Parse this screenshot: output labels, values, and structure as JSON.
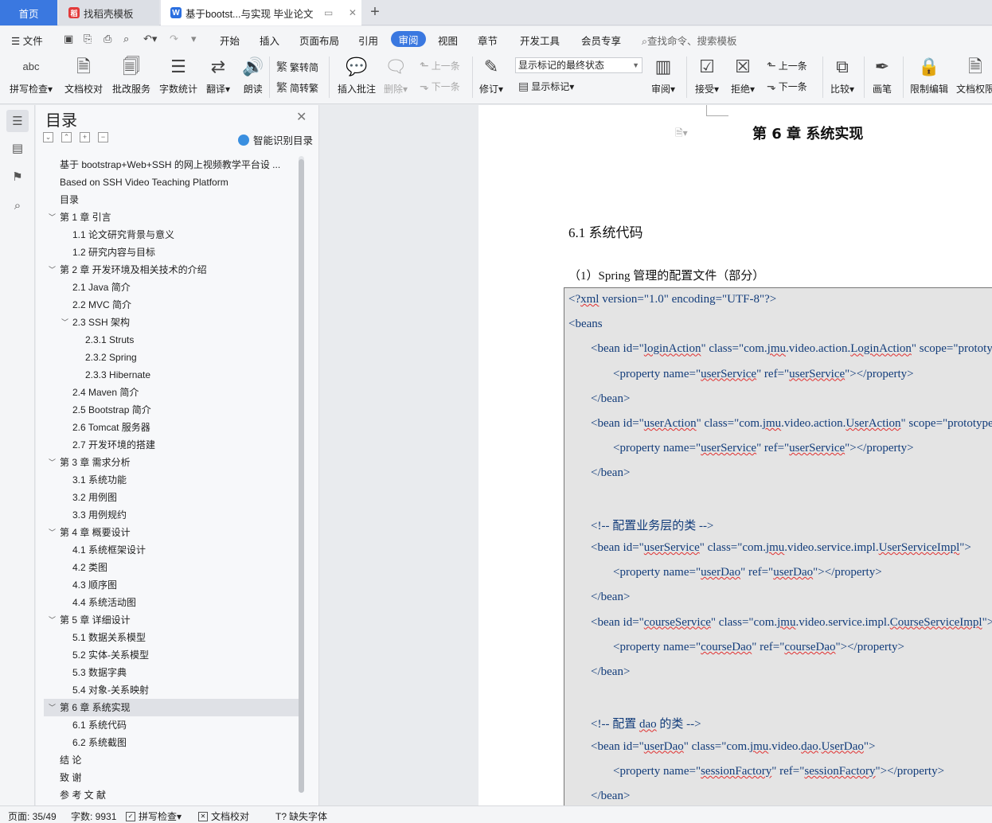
{
  "tabs": {
    "home": "首页",
    "template": "找稻壳模板",
    "doc": "基于bootst...与实现 毕业论文"
  },
  "menu": {
    "file": "文件",
    "items": [
      "开始",
      "插入",
      "页面布局",
      "引用",
      "视图",
      "章节",
      "开发工具",
      "会员专享"
    ],
    "active": "审阅",
    "search": "查找命令、搜索模板"
  },
  "ribbon": {
    "spell": "拼写检查",
    "proof": "文档校对",
    "batch": "批改服务",
    "wordcount": "字数统计",
    "translate": "翻译",
    "read": "朗读",
    "trad2simp": "繁转简",
    "simp2trad": "简转繁",
    "insert_comment": "插入批注",
    "delete": "删除",
    "prev_comment": "上一条",
    "next_comment": "下一条",
    "revise": "修订",
    "markup_state": "显示标记的最终状态",
    "show_markup": "显示标记",
    "review": "审阅",
    "accept": "接受",
    "reject": "拒绝",
    "prev_change": "上一条",
    "next_change": "下一条",
    "compare": "比较",
    "pen": "画笔",
    "restrict": "限制编辑",
    "doc_rights": "文档权限",
    "icon_abc": "abc"
  },
  "toc": {
    "title": "目录",
    "smart": "智能识别目录",
    "items": [
      {
        "t": "基于 bootstrap+Web+SSH 的网上视频教学平台设 ...",
        "lvl": 0,
        "car": ""
      },
      {
        "t": "Based on SSH Video Teaching Platform",
        "lvl": 0,
        "car": ""
      },
      {
        "t": "目录",
        "lvl": 0,
        "car": ""
      },
      {
        "t": "第 1 章  引言",
        "lvl": 0,
        "car": "v"
      },
      {
        "t": "1.1  论文研究背景与意义",
        "lvl": 1,
        "car": ""
      },
      {
        "t": "1.2  研究内容与目标",
        "lvl": 1,
        "car": ""
      },
      {
        "t": "第 2 章  开发环境及相关技术的介绍",
        "lvl": 0,
        "car": "v"
      },
      {
        "t": "2.1 Java 简介",
        "lvl": 1,
        "car": ""
      },
      {
        "t": "2.2 MVC 简介",
        "lvl": 1,
        "car": ""
      },
      {
        "t": "2.3 SSH 架构",
        "lvl": 1,
        "car": "v"
      },
      {
        "t": "2.3.1 Struts",
        "lvl": 2,
        "car": ""
      },
      {
        "t": "2.3.2 Spring",
        "lvl": 2,
        "car": ""
      },
      {
        "t": "2.3.3 Hibernate",
        "lvl": 2,
        "car": ""
      },
      {
        "t": "2.4 Maven 简介",
        "lvl": 1,
        "car": ""
      },
      {
        "t": "2.5 Bootstrap  简介",
        "lvl": 1,
        "car": ""
      },
      {
        "t": "2.6 Tomcat 服务器",
        "lvl": 1,
        "car": ""
      },
      {
        "t": "2.7  开发环境的搭建",
        "lvl": 1,
        "car": ""
      },
      {
        "t": "第 3 章  需求分析",
        "lvl": 0,
        "car": "v"
      },
      {
        "t": "3.1  系统功能",
        "lvl": 1,
        "car": ""
      },
      {
        "t": "3.2  用例图",
        "lvl": 1,
        "car": ""
      },
      {
        "t": "3.3  用例规约",
        "lvl": 1,
        "car": ""
      },
      {
        "t": "第 4 章  概要设计",
        "lvl": 0,
        "car": "v"
      },
      {
        "t": "4.1  系统框架设计",
        "lvl": 1,
        "car": ""
      },
      {
        "t": "4.2  类图",
        "lvl": 1,
        "car": ""
      },
      {
        "t": "4.3  顺序图",
        "lvl": 1,
        "car": ""
      },
      {
        "t": "4.4  系统活动图",
        "lvl": 1,
        "car": ""
      },
      {
        "t": "第 5 章  详细设计",
        "lvl": 0,
        "car": "v"
      },
      {
        "t": "5.1  数据关系模型",
        "lvl": 1,
        "car": ""
      },
      {
        "t": "5.2  实体-关系模型",
        "lvl": 1,
        "car": ""
      },
      {
        "t": "5.3  数据字典",
        "lvl": 1,
        "car": ""
      },
      {
        "t": "5.4  对象-关系映射",
        "lvl": 1,
        "car": ""
      },
      {
        "t": "第 6 章  系统实现",
        "lvl": 0,
        "car": "v",
        "sel": true
      },
      {
        "t": "6.1  系统代码",
        "lvl": 1,
        "car": ""
      },
      {
        "t": "6.2  系统截图",
        "lvl": 1,
        "car": ""
      },
      {
        "t": "结    论",
        "lvl": 0,
        "car": ""
      },
      {
        "t": "致    谢",
        "lvl": 0,
        "car": ""
      },
      {
        "t": "参 考 文 献",
        "lvl": 0,
        "car": ""
      }
    ]
  },
  "doc": {
    "chapter": "第 6 章  系统实现",
    "section": "6.1  系统代码",
    "subheading": "（1）Spring 管理的配置文件（部分）",
    "code": [
      {
        "i": 0,
        "s": [
          [
            "<?"
          ],
          [
            "xml",
            "w"
          ],
          [
            " version=\"1.0\" encoding=\"UTF-8\"?>"
          ]
        ]
      },
      {
        "i": 0,
        "s": [
          [
            "<beans"
          ]
        ]
      },
      {
        "i": 1,
        "s": [
          [
            "<bean id=\""
          ],
          [
            "loginAction",
            "w"
          ],
          [
            "\" class=\"com."
          ],
          [
            "jmu",
            "w"
          ],
          [
            ".video.action."
          ],
          [
            "LoginAction",
            "w"
          ],
          [
            "\" scope=\"prototype\">"
          ]
        ]
      },
      {
        "i": 2,
        "s": [
          [
            "<property name=\""
          ],
          [
            "userService",
            "w"
          ],
          [
            "\"  ref=\""
          ],
          [
            "userService",
            "w"
          ],
          [
            "\"></property>"
          ]
        ]
      },
      {
        "i": 1,
        "s": [
          [
            "</bean>"
          ]
        ]
      },
      {
        "i": 1,
        "s": [
          [
            "<bean id=\""
          ],
          [
            "userAction",
            "w"
          ],
          [
            "\" class=\"com."
          ],
          [
            "jmu",
            "w"
          ],
          [
            ".video.action."
          ],
          [
            "UserAction",
            "w"
          ],
          [
            "\" scope=\"prototype\">"
          ]
        ]
      },
      {
        "i": 2,
        "s": [
          [
            "<property name=\""
          ],
          [
            "userService",
            "w"
          ],
          [
            "\"  ref=\""
          ],
          [
            "userService",
            "w"
          ],
          [
            "\"></property>"
          ]
        ]
      },
      {
        "i": 1,
        "s": [
          [
            "</bean>"
          ]
        ]
      },
      {
        "i": 0,
        "s": [
          [
            ""
          ]
        ]
      },
      {
        "i": 1,
        "s": [
          [
            "<!--  配置业务层的类  -->"
          ]
        ]
      },
      {
        "i": 1,
        "s": [
          [
            "<bean id=\""
          ],
          [
            "userService",
            "w"
          ],
          [
            "\" class=\"com."
          ],
          [
            "jmu",
            "w"
          ],
          [
            ".video.service.impl."
          ],
          [
            "UserServiceImpl",
            "w"
          ],
          [
            "\">"
          ]
        ]
      },
      {
        "i": 2,
        "s": [
          [
            "<property name=\""
          ],
          [
            "userDao",
            "w"
          ],
          [
            "\" ref=\""
          ],
          [
            "userDao",
            "w"
          ],
          [
            "\"></property>"
          ]
        ]
      },
      {
        "i": 1,
        "s": [
          [
            "</bean>"
          ]
        ]
      },
      {
        "i": 1,
        "s": [
          [
            "<bean id=\""
          ],
          [
            "courseService",
            "w"
          ],
          [
            "\"  class=\"com."
          ],
          [
            "jmu",
            "w"
          ],
          [
            ".video.service.impl."
          ],
          [
            "CourseServiceImpl",
            "w"
          ],
          [
            "\">"
          ]
        ]
      },
      {
        "i": 2,
        "s": [
          [
            "<property name=\""
          ],
          [
            "courseDao",
            "w"
          ],
          [
            "\" ref=\""
          ],
          [
            "courseDao",
            "w"
          ],
          [
            "\"></property>"
          ]
        ]
      },
      {
        "i": 1,
        "s": [
          [
            "</bean>"
          ]
        ]
      },
      {
        "i": 0,
        "s": [
          [
            ""
          ]
        ]
      },
      {
        "i": 1,
        "s": [
          [
            "<!--  配置 "
          ],
          [
            "dao",
            "w"
          ],
          [
            " 的类  -->"
          ]
        ]
      },
      {
        "i": 1,
        "s": [
          [
            "<bean id=\""
          ],
          [
            "userDao",
            "w"
          ],
          [
            "\" class=\"com."
          ],
          [
            "jmu",
            "w"
          ],
          [
            ".video."
          ],
          [
            "dao",
            "w"
          ],
          [
            "."
          ],
          [
            "UserDao",
            "w"
          ],
          [
            "\">"
          ]
        ]
      },
      {
        "i": 2,
        "s": [
          [
            "<property name=\""
          ],
          [
            "sessionFactory",
            "w"
          ],
          [
            "\" ref=\""
          ],
          [
            "sessionFactory",
            "w"
          ],
          [
            "\"></property>"
          ]
        ]
      },
      {
        "i": 1,
        "s": [
          [
            "</bean>"
          ]
        ]
      }
    ]
  },
  "status": {
    "page": "页面: 35/49",
    "words": "字数: 9931",
    "spell": "拼写检查",
    "proof": "文档校对",
    "font": "缺失字体"
  },
  "colors": {
    "accent": "#3a78e0",
    "code_text": "#123c7a",
    "code_bg": "#e4e4e4"
  }
}
